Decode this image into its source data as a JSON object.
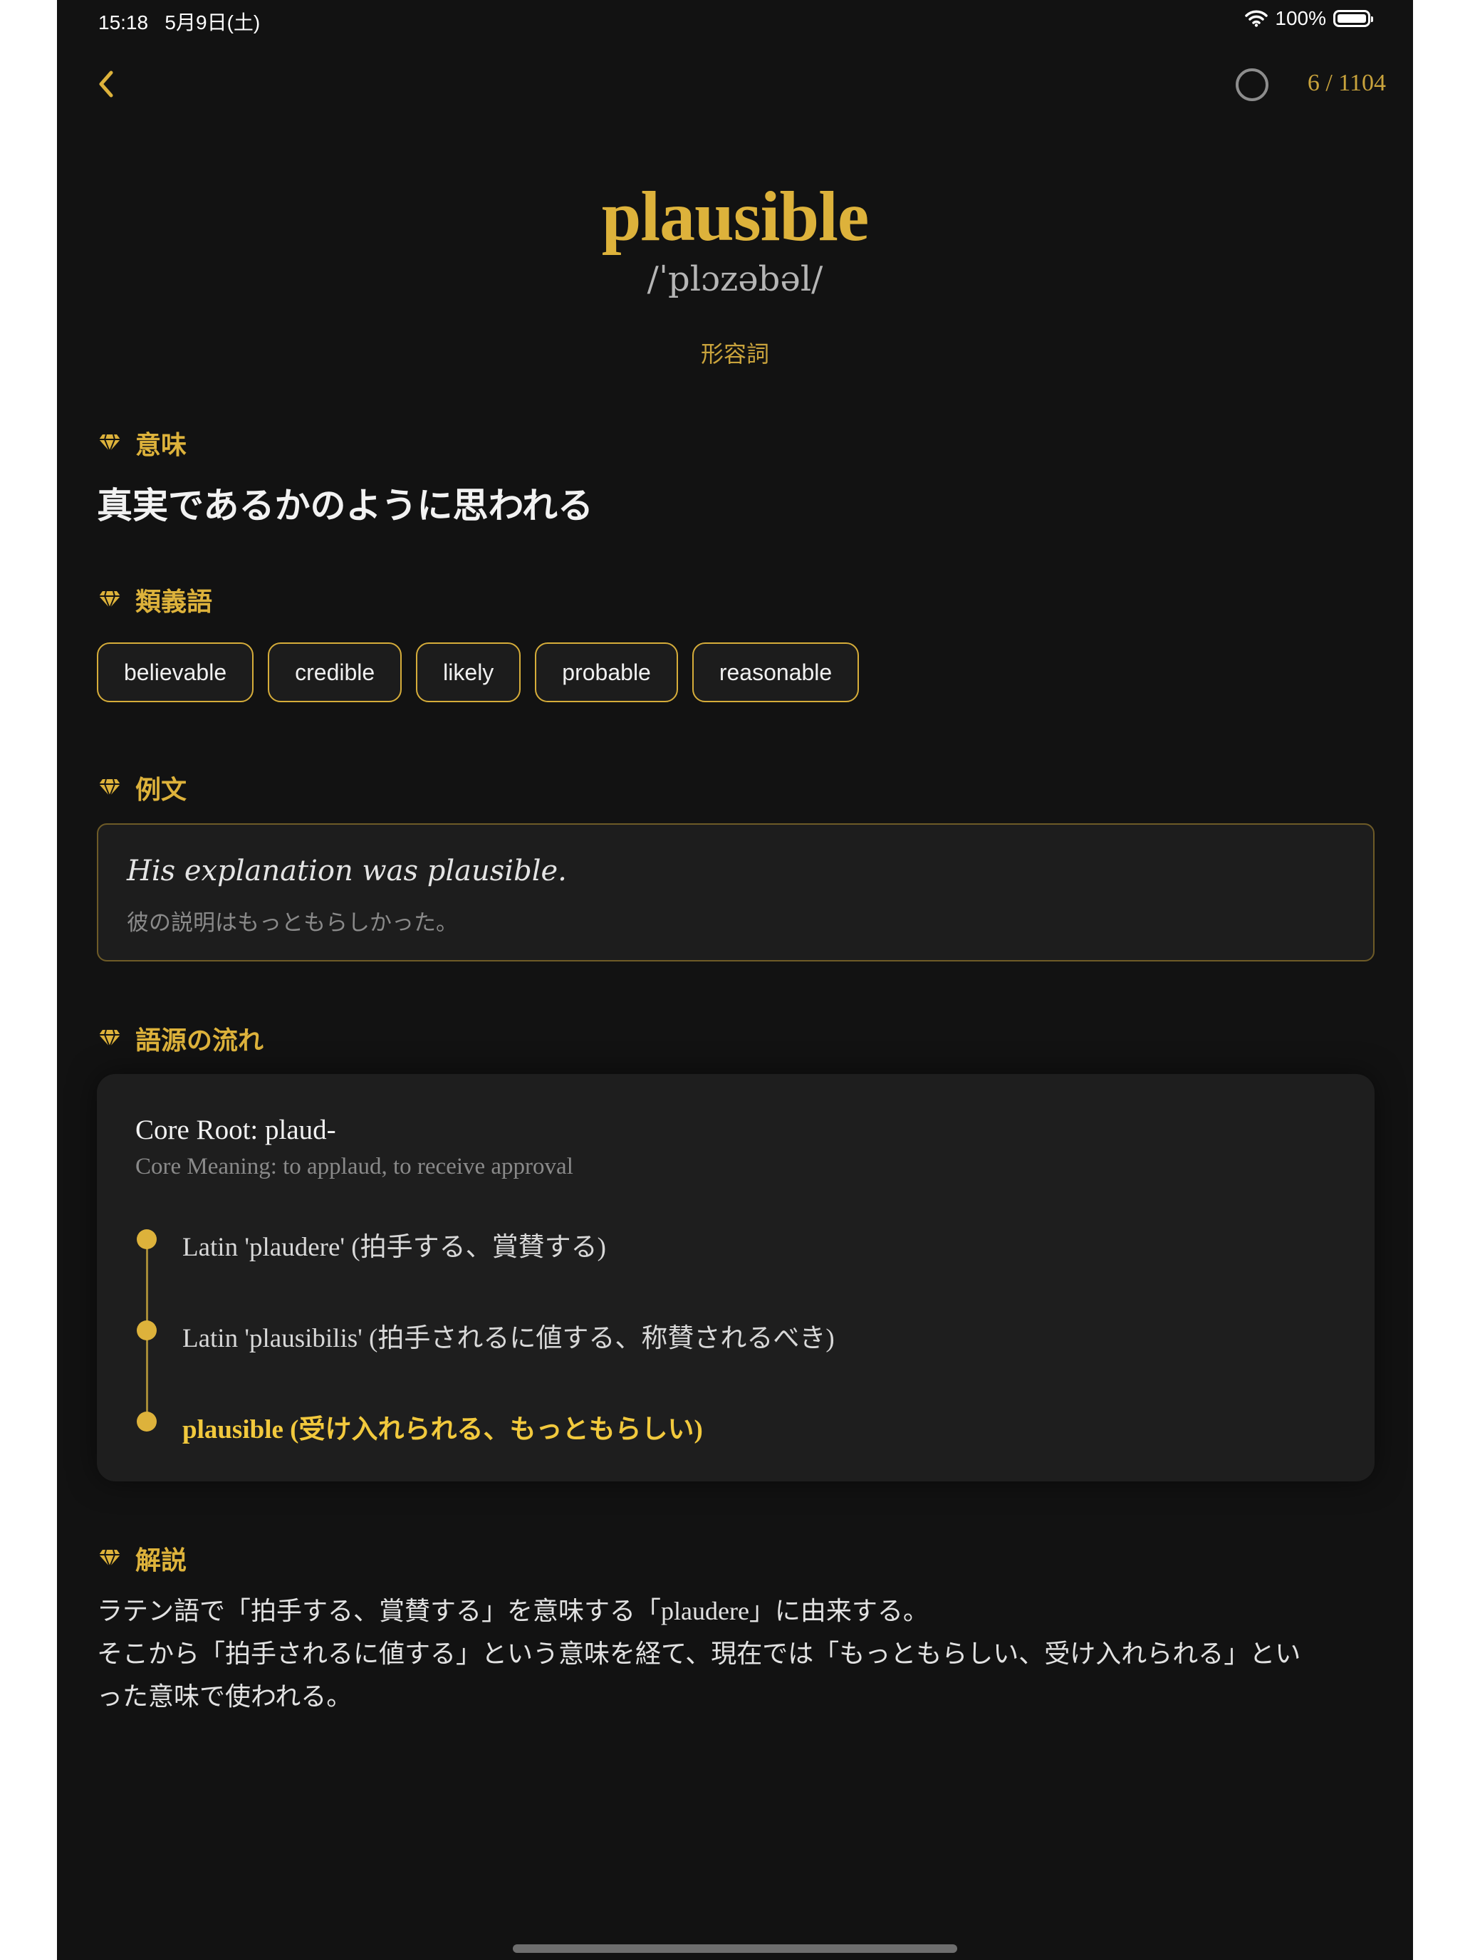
{
  "status": {
    "time": "15:18",
    "date": "5月9日(土)",
    "battery": "100%",
    "battery_level": 1.0
  },
  "nav": {
    "counter": "6 / 1104"
  },
  "word": {
    "text": "plausible",
    "phonetic": "/ˈplɔzəbəl/",
    "part_of_speech": "形容詞"
  },
  "sections": {
    "meaning": {
      "title": "意味",
      "text": "真実であるかのように思われる"
    },
    "synonyms": {
      "title": "類義語",
      "items": [
        "believable",
        "credible",
        "likely",
        "probable",
        "reasonable"
      ]
    },
    "example": {
      "title": "例文",
      "english": "His explanation was plausible.",
      "japanese": "彼の説明はもっともらしかった。"
    },
    "etymology": {
      "title": "語源の流れ",
      "core_root": "Core Root: plaud-",
      "core_meaning": "Core Meaning: to applaud, to receive approval",
      "steps": [
        "Latin 'plaudere' (拍手する、賞賛する)",
        "Latin 'plausibilis' (拍手されるに値する、称賛されるべき)",
        "plausible (受け入れられる、もっともらしい)"
      ]
    },
    "explanation": {
      "title": "解説",
      "line1": "ラテン語で「拍手する、賞賛する」を意味する「plaudere」に由来する。",
      "line2": "そこから「拍手されるに値する」という意味を経て、現在では「もっともらしい、受け入れられる」とい",
      "line3": "った意味で使われる。"
    }
  },
  "colors": {
    "background": "#121212",
    "accent": "#ddb23b",
    "card": "#1e1e1e"
  },
  "icons": {
    "back": "chevron-left-icon",
    "section": "diamond-icon",
    "progress": "circle-icon",
    "wifi": "wifi-icon",
    "battery": "battery-icon"
  }
}
